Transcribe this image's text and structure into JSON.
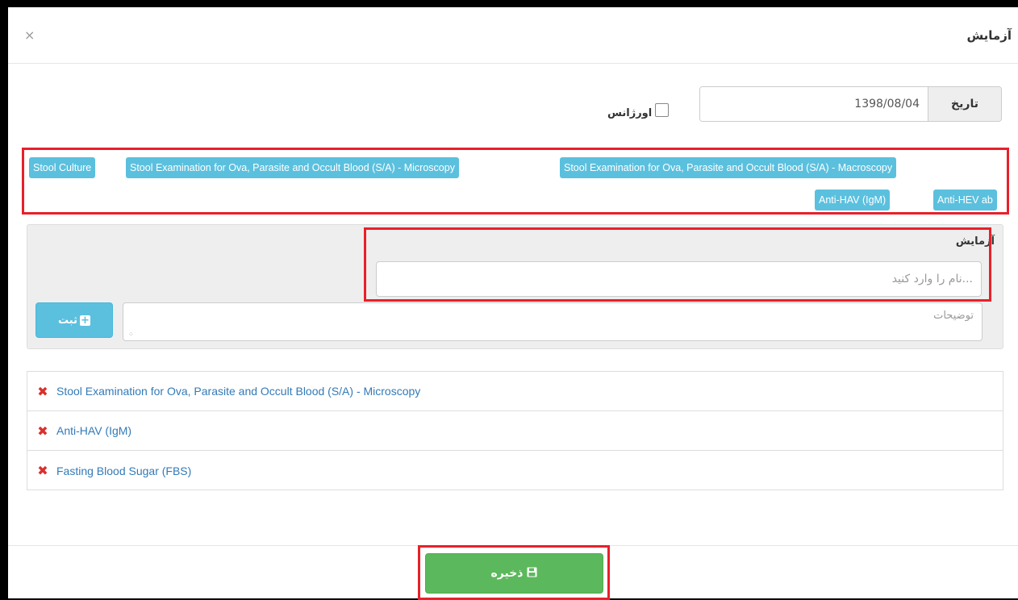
{
  "modal": {
    "title": "آزمایش",
    "close_icon": "×"
  },
  "form": {
    "date_label": "تاریخ",
    "date_value": "1398/08/04",
    "urgent_label": "اورژانس",
    "urgent_checked": false
  },
  "tags": [
    "Stool Culture",
    "Stool Examination for Ova, Parasite and Occult Blood (S/A) - Microscopy",
    "Stool Examination for Ova, Parasite and Occult Blood (S/A) - Macroscopy",
    "Anti-HAV (IgM)",
    "Anti-HEV ab"
  ],
  "panel": {
    "label": "آزمایش",
    "name_placeholder": "نام را وارد کنید...",
    "desc_placeholder": "توضیحات",
    "submit_label": "ثبت"
  },
  "selected_tests": [
    "Stool Examination for Ova, Parasite and Occult Blood (S/A) - Microscopy",
    "Anti-HAV (IgM)",
    "Fasting Blood Sugar (FBS)"
  ],
  "footer": {
    "save_label": "ذخیره"
  },
  "colors": {
    "tag": "#5bc0de",
    "save": "#5cb85c",
    "remove": "#d9302c",
    "link": "#337ab7",
    "highlight": "#e8202a"
  },
  "icons": [
    "close-icon",
    "checkbox-icon",
    "plus-icon",
    "remove-icon",
    "floppy-disk-icon"
  ]
}
